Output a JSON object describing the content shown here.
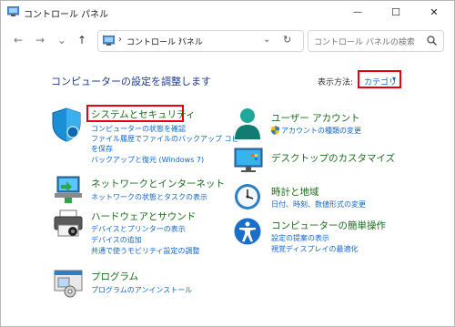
{
  "window": {
    "title": "コントロール パネル",
    "controls": {
      "minimize": "—",
      "maximize": "☐",
      "close": "✕"
    }
  },
  "nav": {
    "back": "←",
    "forward": "→",
    "recent": "⌄",
    "up": "↑",
    "address": {
      "separator": "›",
      "path": "コントロール パネル",
      "separator2": "›",
      "dropdown": "⌄",
      "refresh": "↻"
    },
    "search_placeholder": "コントロール パネルの検索"
  },
  "main": {
    "heading": "コンピューターの設定を調整します",
    "view_by": {
      "label": "表示方法:",
      "value": "カテゴリ",
      "caret": "▾"
    }
  },
  "categories_left": [
    {
      "title": "システムとセキュリティ",
      "icon": "shield-icon",
      "links": [
        "コンピューターの状態を確認",
        "ファイル履歴でファイルのバックアップ コピー",
        "を保存",
        "バックアップと復元 (Windows 7)"
      ]
    },
    {
      "title": "ネットワークとインターネット",
      "icon": "network-icon",
      "links": [
        "ネットワークの状態とタスクの表示"
      ]
    },
    {
      "title": "ハードウェアとサウンド",
      "icon": "printer-icon",
      "links": [
        "デバイスとプリンターの表示",
        "デバイスの追加",
        "共通で使うモビリティ設定の調整"
      ]
    },
    {
      "title": "プログラム",
      "icon": "programs-icon",
      "links": [
        "プログラムのアンインストール"
      ]
    }
  ],
  "categories_right": [
    {
      "title": "ユーザー アカウント",
      "icon": "user-icon",
      "links": [
        "アカウントの種類の変更"
      ]
    },
    {
      "title": "デスクトップのカスタマイズ",
      "icon": "monitor-icon",
      "links": []
    },
    {
      "title": "時計と地域",
      "icon": "clock-icon",
      "links": [
        "日付、時刻、数値形式の変更"
      ]
    },
    {
      "title": "コンピューターの簡単操作",
      "icon": "accessibility-icon",
      "links": [
        "設定の提案の表示",
        "視覚ディスプレイの最適化"
      ]
    }
  ],
  "colors": {
    "category_title": "#1a6b1a",
    "link": "#1366c9",
    "heading": "#1f3a8a",
    "highlight": "#e60012"
  }
}
